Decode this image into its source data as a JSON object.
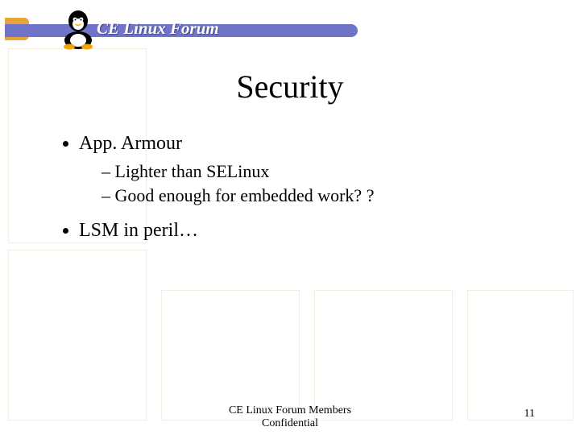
{
  "header": {
    "forum_name": "CE Linux Forum"
  },
  "slide": {
    "title": "Security",
    "bullets": [
      {
        "text": "App. Armour",
        "sub": [
          "Lighter than SELinux",
          "Good enough for embedded work? ?"
        ]
      },
      {
        "text": "LSM in peril…",
        "sub": []
      }
    ]
  },
  "footer": {
    "line1": "CE Linux Forum Members",
    "line2": "Confidential",
    "page": "11"
  }
}
